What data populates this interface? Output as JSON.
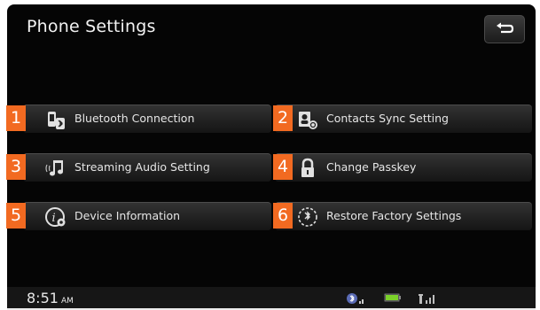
{
  "header": {
    "title": "Phone Settings",
    "back_icon": "return-arrow-icon"
  },
  "menu": [
    {
      "number": "1",
      "label": "Bluetooth Connection",
      "icon": "bluetooth-phone-icon"
    },
    {
      "number": "2",
      "label": "Contacts Sync Setting",
      "icon": "contacts-sync-icon"
    },
    {
      "number": "3",
      "label": "Streaming Audio Setting",
      "icon": "streaming-audio-icon"
    },
    {
      "number": "4",
      "label": "Change Passkey",
      "icon": "lock-icon"
    },
    {
      "number": "5",
      "label": "Device Information",
      "icon": "info-icon"
    },
    {
      "number": "6",
      "label": "Restore Factory Settings",
      "icon": "restore-icon"
    }
  ],
  "status": {
    "time": "8:51",
    "ampm": "AM",
    "icons": [
      "bluetooth-status-icon",
      "battery-icon",
      "signal-strength-icon"
    ]
  },
  "colors": {
    "number_badge": "#f26a21",
    "screen_bg": "#050505"
  }
}
